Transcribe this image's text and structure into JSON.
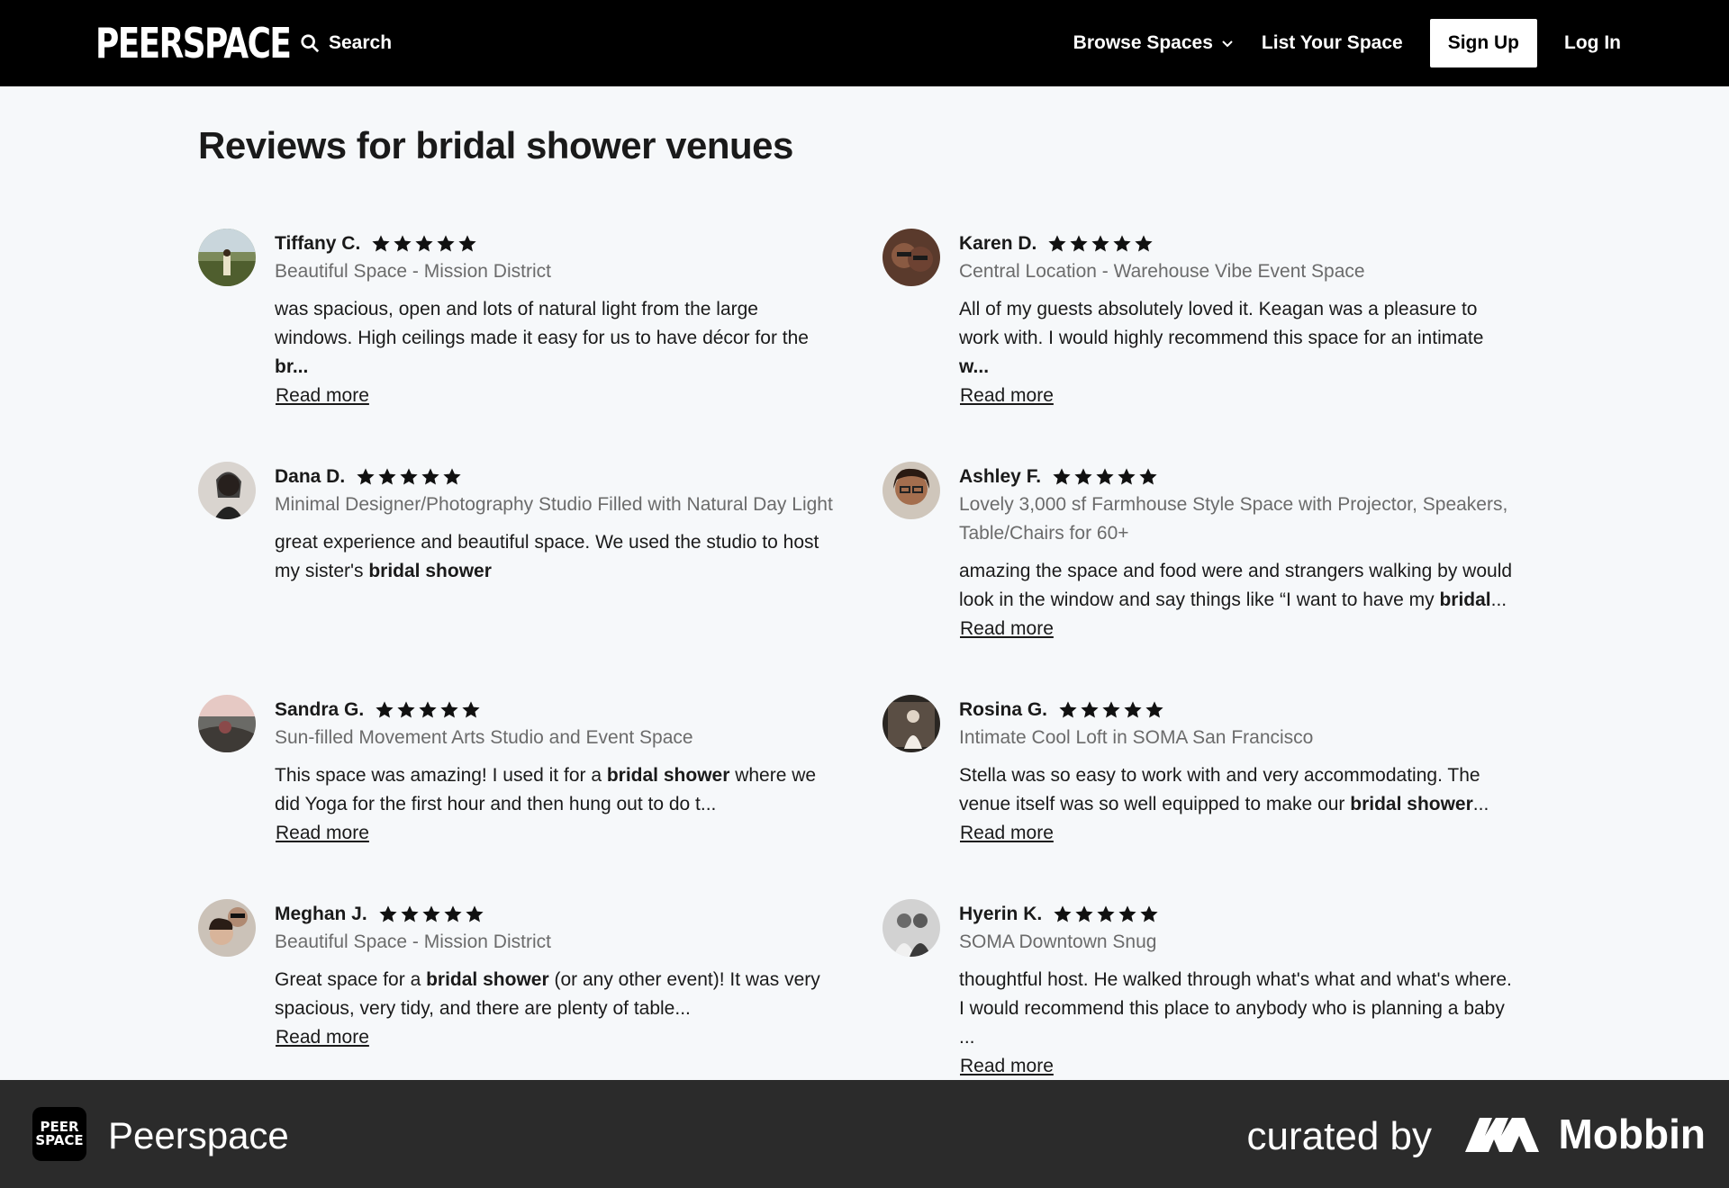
{
  "header": {
    "logo": "PEERSPACE",
    "search_label": "Search",
    "nav": {
      "browse": "Browse Spaces",
      "list_space": "List Your Space",
      "sign_up": "Sign Up",
      "log_in": "Log In"
    }
  },
  "main": {
    "title": "Reviews for bridal shower venues",
    "read_more_label": "Read more",
    "reviews": [
      {
        "name": "Tiffany C.",
        "rating": 5,
        "space": "Beautiful Space - Mission District",
        "text_html": "was spacious, open and lots of natural light from the large windows. High ceilings made it easy for us to have décor for the <b>br...</b>"
      },
      {
        "name": "Karen D.",
        "rating": 5,
        "space": "Central Location - Warehouse Vibe Event Space",
        "text_html": "All of my guests absolutely loved it. Keagan was a pleasure to work with. I would highly recommend this space for an intimate <b>w...</b>"
      },
      {
        "name": "Dana D.",
        "rating": 5,
        "space": "Minimal Designer/Photography Studio Filled with Natural Day Light",
        "text_html": "great experience and beautiful space. We used the studio to host my sister's <b>bridal shower</b>"
      },
      {
        "name": "Ashley F.",
        "rating": 5,
        "space": "Lovely 3,000 sf Farmhouse Style Space with Projector, Speakers, Table/Chairs for 60+",
        "text_html": "amazing the space and food were and strangers walking by would look in the window and say things like “I want to have my <b>bridal</b>..."
      },
      {
        "name": "Sandra G.",
        "rating": 5,
        "space": "Sun-filled Movement Arts Studio and Event Space",
        "text_html": "This space was amazing! I used it for a <b>bridal shower</b> where we did Yoga for the first hour and then hung out to do t..."
      },
      {
        "name": "Rosina G.",
        "rating": 5,
        "space": "Intimate Cool Loft in SOMA San Francisco",
        "text_html": "Stella was so easy to work with and very accommodating. The venue itself was so well equipped to make our <b>bridal shower</b>..."
      },
      {
        "name": "Meghan J.",
        "rating": 5,
        "space": "Beautiful Space - Mission District",
        "text_html": "Great space for a <b>bridal shower</b> (or any other event)! It was very spacious, very tidy, and there are plenty of table..."
      },
      {
        "name": "Hyerin K.",
        "rating": 5,
        "space": "SOMA Downtown Snug",
        "text_html": "thoughtful host. He walked through what's what and what's where. I would recommend this place to anybody who is planning a baby ..."
      }
    ]
  },
  "footer": {
    "app_icon_text": "PEER SPACE",
    "app_name": "Peerspace",
    "curated_by": "curated by",
    "brand": "Mobbin"
  },
  "colors": {
    "header_bg": "#000000",
    "page_bg": "#f6f8fa",
    "footer_bg": "#2b2b2b",
    "muted_text": "#6b6b6b",
    "star": "#111111"
  }
}
